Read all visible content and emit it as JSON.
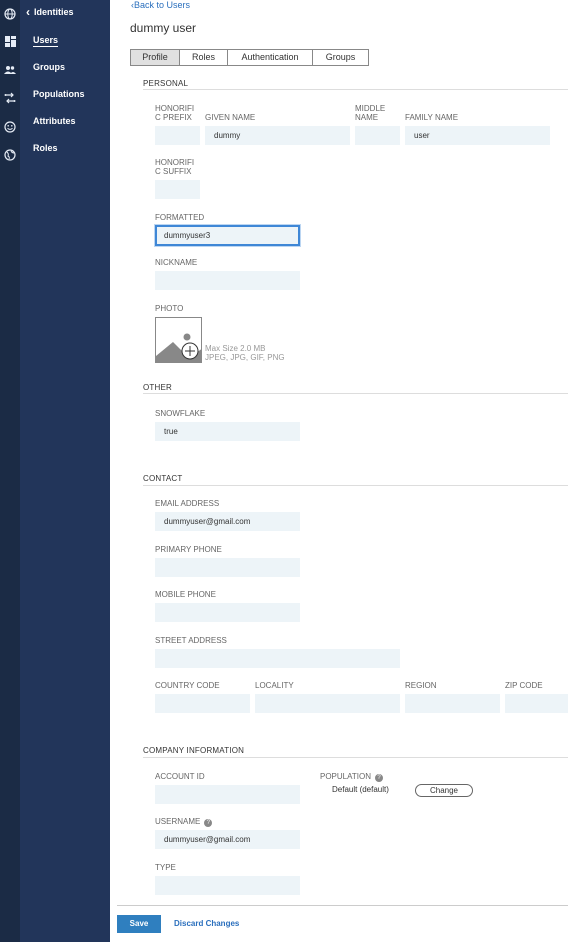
{
  "nav": {
    "header": "Identities",
    "items": [
      {
        "label": "Users"
      },
      {
        "label": "Groups"
      },
      {
        "label": "Populations"
      },
      {
        "label": "Attributes"
      },
      {
        "label": "Roles"
      }
    ]
  },
  "rail_icons": [
    "globe-icon",
    "dashboard-icon",
    "users-icon",
    "connections-icon",
    "smiley-icon",
    "globe-outline-icon"
  ],
  "page": {
    "back_link": "Back to Users",
    "title": "dummy user"
  },
  "tabs": [
    {
      "label": "Profile",
      "active": true
    },
    {
      "label": "Roles",
      "active": false
    },
    {
      "label": "Authentication",
      "active": false
    },
    {
      "label": "Groups",
      "active": false
    }
  ],
  "personal": {
    "section": "PERSONAL",
    "honorific_prefix": {
      "label": "HONORIFI C PREFIX",
      "line1": "HONORIFI",
      "line2": "C PREFIX",
      "value": ""
    },
    "given_name": {
      "label": "GIVEN NAME",
      "value": "dummy"
    },
    "middle_name": {
      "label": "MIDDLE NAME",
      "line1": "MIDDLE",
      "line2": "NAME",
      "value": ""
    },
    "family_name": {
      "label": "FAMILY NAME",
      "value": "user"
    },
    "honorific_suffix": {
      "label": "HONORIFI C SUFFIX",
      "line1": "HONORIFI",
      "line2": "C SUFFIX",
      "value": ""
    },
    "formatted": {
      "label": "FORMATTED",
      "value": "dummyuser3"
    },
    "nickname": {
      "label": "NICKNAME",
      "value": ""
    },
    "photo": {
      "label": "PHOTO",
      "hint1": "Max Size 2.0 MB",
      "hint2": "JPEG, JPG, GIF, PNG"
    }
  },
  "other": {
    "section": "OTHER",
    "snowflake": {
      "label": "SNOWFLAKE",
      "value": "true"
    }
  },
  "contact": {
    "section": "CONTACT",
    "email": {
      "label": "EMAIL ADDRESS",
      "value": "dummyuser@gmail.com"
    },
    "primary_phone": {
      "label": "PRIMARY PHONE",
      "value": ""
    },
    "mobile_phone": {
      "label": "MOBILE PHONE",
      "value": ""
    },
    "street_address": {
      "label": "STREET ADDRESS",
      "value": ""
    },
    "country_code": {
      "label": "COUNTRY CODE",
      "value": ""
    },
    "locality": {
      "label": "LOCALITY",
      "value": ""
    },
    "region": {
      "label": "REGION",
      "value": ""
    },
    "zip_code": {
      "label": "ZIP CODE",
      "value": ""
    }
  },
  "company": {
    "section": "COMPANY INFORMATION",
    "account_id": {
      "label": "ACCOUNT ID",
      "value": ""
    },
    "population": {
      "label": "POPULATION",
      "value": "Default (default)",
      "change_label": "Change"
    },
    "username": {
      "label": "USERNAME",
      "value": "dummyuser@gmail.com"
    },
    "type": {
      "label": "TYPE",
      "value": ""
    }
  },
  "footer": {
    "save_label": "Save",
    "discard_label": "Discard Changes"
  },
  "colors": {
    "rail": "#1b2b45",
    "nav": "#22355a",
    "accent": "#2f7fbf",
    "field_bg": "#edf4f8"
  }
}
